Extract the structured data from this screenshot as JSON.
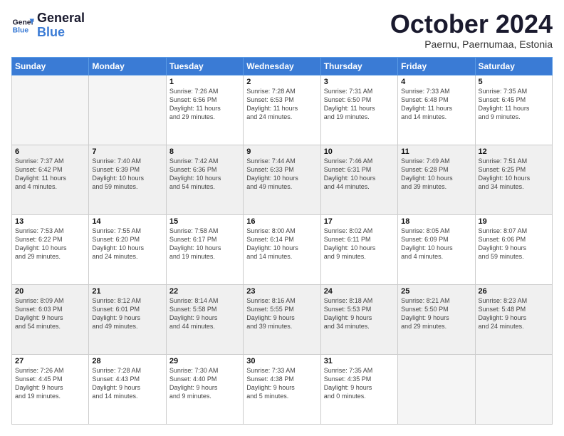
{
  "header": {
    "logo_line1": "General",
    "logo_line2": "Blue",
    "month": "October 2024",
    "location": "Paernu, Paernumaa, Estonia"
  },
  "weekdays": [
    "Sunday",
    "Monday",
    "Tuesday",
    "Wednesday",
    "Thursday",
    "Friday",
    "Saturday"
  ],
  "weeks": [
    [
      {
        "day": "",
        "info": ""
      },
      {
        "day": "",
        "info": ""
      },
      {
        "day": "1",
        "info": "Sunrise: 7:26 AM\nSunset: 6:56 PM\nDaylight: 11 hours\nand 29 minutes."
      },
      {
        "day": "2",
        "info": "Sunrise: 7:28 AM\nSunset: 6:53 PM\nDaylight: 11 hours\nand 24 minutes."
      },
      {
        "day": "3",
        "info": "Sunrise: 7:31 AM\nSunset: 6:50 PM\nDaylight: 11 hours\nand 19 minutes."
      },
      {
        "day": "4",
        "info": "Sunrise: 7:33 AM\nSunset: 6:48 PM\nDaylight: 11 hours\nand 14 minutes."
      },
      {
        "day": "5",
        "info": "Sunrise: 7:35 AM\nSunset: 6:45 PM\nDaylight: 11 hours\nand 9 minutes."
      }
    ],
    [
      {
        "day": "6",
        "info": "Sunrise: 7:37 AM\nSunset: 6:42 PM\nDaylight: 11 hours\nand 4 minutes."
      },
      {
        "day": "7",
        "info": "Sunrise: 7:40 AM\nSunset: 6:39 PM\nDaylight: 10 hours\nand 59 minutes."
      },
      {
        "day": "8",
        "info": "Sunrise: 7:42 AM\nSunset: 6:36 PM\nDaylight: 10 hours\nand 54 minutes."
      },
      {
        "day": "9",
        "info": "Sunrise: 7:44 AM\nSunset: 6:33 PM\nDaylight: 10 hours\nand 49 minutes."
      },
      {
        "day": "10",
        "info": "Sunrise: 7:46 AM\nSunset: 6:31 PM\nDaylight: 10 hours\nand 44 minutes."
      },
      {
        "day": "11",
        "info": "Sunrise: 7:49 AM\nSunset: 6:28 PM\nDaylight: 10 hours\nand 39 minutes."
      },
      {
        "day": "12",
        "info": "Sunrise: 7:51 AM\nSunset: 6:25 PM\nDaylight: 10 hours\nand 34 minutes."
      }
    ],
    [
      {
        "day": "13",
        "info": "Sunrise: 7:53 AM\nSunset: 6:22 PM\nDaylight: 10 hours\nand 29 minutes."
      },
      {
        "day": "14",
        "info": "Sunrise: 7:55 AM\nSunset: 6:20 PM\nDaylight: 10 hours\nand 24 minutes."
      },
      {
        "day": "15",
        "info": "Sunrise: 7:58 AM\nSunset: 6:17 PM\nDaylight: 10 hours\nand 19 minutes."
      },
      {
        "day": "16",
        "info": "Sunrise: 8:00 AM\nSunset: 6:14 PM\nDaylight: 10 hours\nand 14 minutes."
      },
      {
        "day": "17",
        "info": "Sunrise: 8:02 AM\nSunset: 6:11 PM\nDaylight: 10 hours\nand 9 minutes."
      },
      {
        "day": "18",
        "info": "Sunrise: 8:05 AM\nSunset: 6:09 PM\nDaylight: 10 hours\nand 4 minutes."
      },
      {
        "day": "19",
        "info": "Sunrise: 8:07 AM\nSunset: 6:06 PM\nDaylight: 9 hours\nand 59 minutes."
      }
    ],
    [
      {
        "day": "20",
        "info": "Sunrise: 8:09 AM\nSunset: 6:03 PM\nDaylight: 9 hours\nand 54 minutes."
      },
      {
        "day": "21",
        "info": "Sunrise: 8:12 AM\nSunset: 6:01 PM\nDaylight: 9 hours\nand 49 minutes."
      },
      {
        "day": "22",
        "info": "Sunrise: 8:14 AM\nSunset: 5:58 PM\nDaylight: 9 hours\nand 44 minutes."
      },
      {
        "day": "23",
        "info": "Sunrise: 8:16 AM\nSunset: 5:55 PM\nDaylight: 9 hours\nand 39 minutes."
      },
      {
        "day": "24",
        "info": "Sunrise: 8:18 AM\nSunset: 5:53 PM\nDaylight: 9 hours\nand 34 minutes."
      },
      {
        "day": "25",
        "info": "Sunrise: 8:21 AM\nSunset: 5:50 PM\nDaylight: 9 hours\nand 29 minutes."
      },
      {
        "day": "26",
        "info": "Sunrise: 8:23 AM\nSunset: 5:48 PM\nDaylight: 9 hours\nand 24 minutes."
      }
    ],
    [
      {
        "day": "27",
        "info": "Sunrise: 7:26 AM\nSunset: 4:45 PM\nDaylight: 9 hours\nand 19 minutes."
      },
      {
        "day": "28",
        "info": "Sunrise: 7:28 AM\nSunset: 4:43 PM\nDaylight: 9 hours\nand 14 minutes."
      },
      {
        "day": "29",
        "info": "Sunrise: 7:30 AM\nSunset: 4:40 PM\nDaylight: 9 hours\nand 9 minutes."
      },
      {
        "day": "30",
        "info": "Sunrise: 7:33 AM\nSunset: 4:38 PM\nDaylight: 9 hours\nand 5 minutes."
      },
      {
        "day": "31",
        "info": "Sunrise: 7:35 AM\nSunset: 4:35 PM\nDaylight: 9 hours\nand 0 minutes."
      },
      {
        "day": "",
        "info": ""
      },
      {
        "day": "",
        "info": ""
      }
    ]
  ]
}
